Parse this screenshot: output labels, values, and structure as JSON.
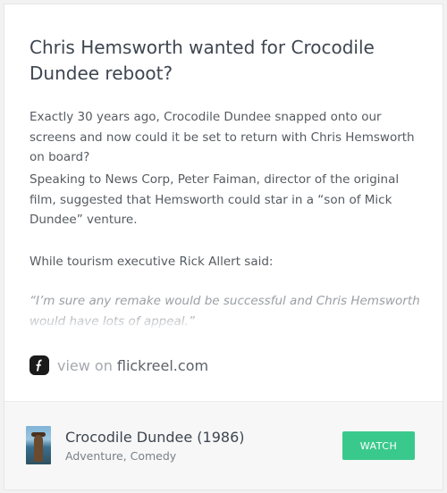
{
  "article": {
    "title": "Chris Hemsworth wanted for Crocodile Dundee reboot?",
    "paragraphs": [
      "Exactly 30 years ago, Crocodile Dundee snapped onto our screens and now could it be set to return with Chris Hemsworth on board?",
      "Speaking to News Corp, Peter Faiman, director of the original film, suggested that Hemsworth could star in a “son of Mick Dundee” venture.",
      "While tourism executive Rick Allert said:"
    ],
    "quote": "“I’m sure any remake would be successful and Chris Hemsworth would have lots of appeal.”"
  },
  "source": {
    "icon": "flickreel-f-icon",
    "prefix": "view on",
    "domain": "flickreel.com"
  },
  "movie": {
    "title": "Crocodile Dundee (1986)",
    "genres": "Adventure, Comedy",
    "watch_label": "WATCH"
  },
  "colors": {
    "accent": "#3ac98c",
    "title": "#3e4650",
    "body": "#555b61",
    "muted": "#9aa0a6"
  }
}
